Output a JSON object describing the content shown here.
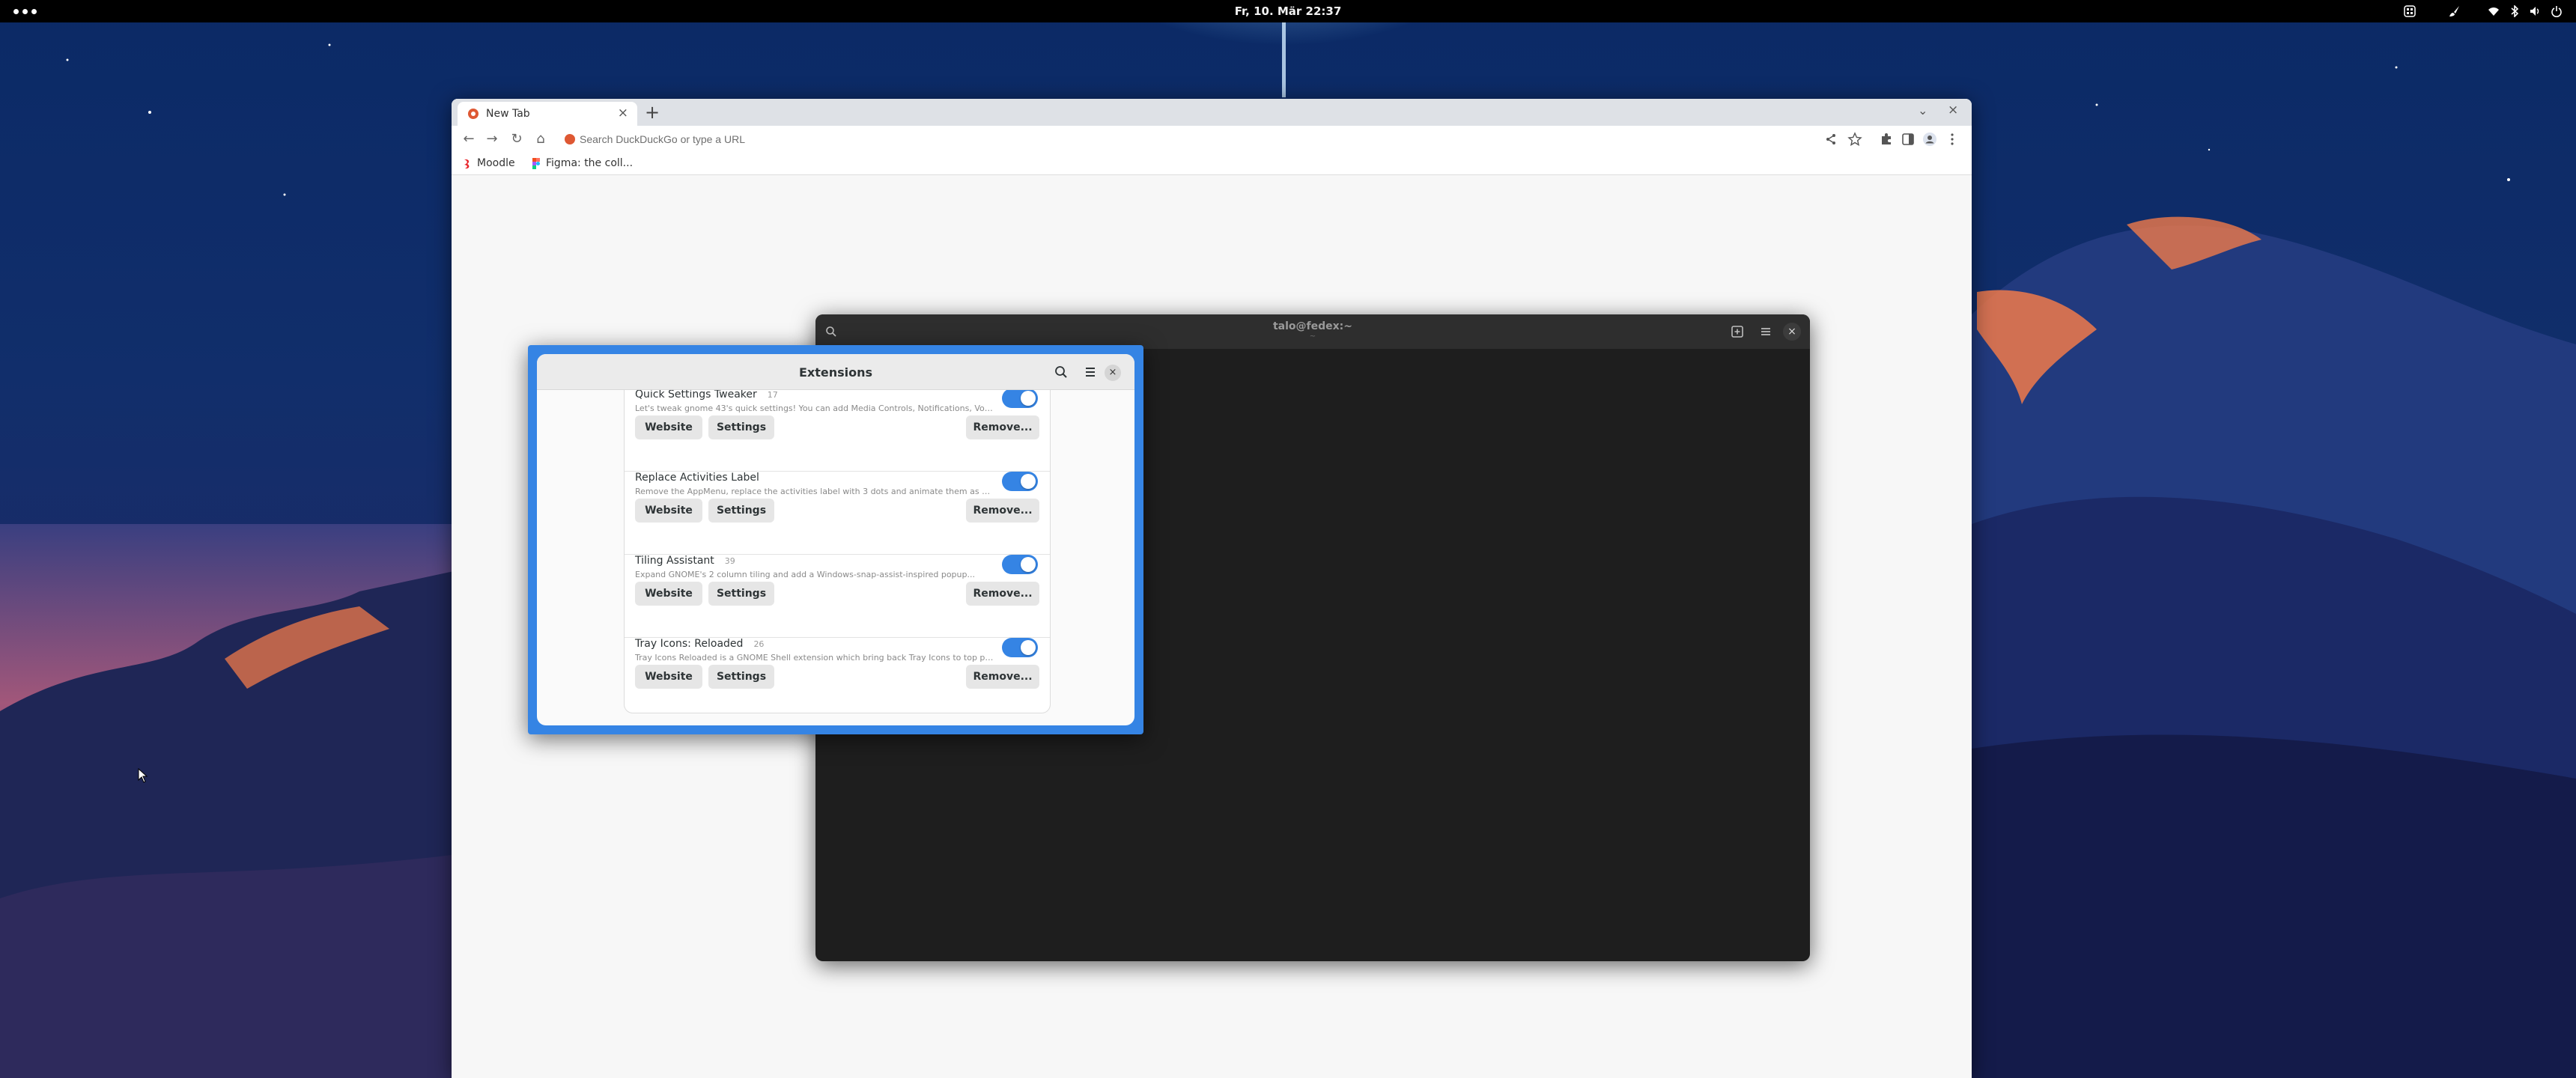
{
  "top_bar": {
    "clock": "Fr, 10. Mär  22:37",
    "tray_icons": [
      "grid-icon",
      "brush-icon",
      "wifi-icon",
      "bluetooth-icon",
      "volume-icon",
      "power-icon"
    ]
  },
  "browser": {
    "tab_title": "New Tab",
    "search_placeholder": "Search DuckDuckGo or type a URL",
    "bookmarks": [
      {
        "label": "Moodle",
        "color": "#e8242a"
      },
      {
        "label": "Figma: the coll...",
        "color": "#f24e1e"
      }
    ]
  },
  "terminal": {
    "title": "talo@fedex:~",
    "subtitle": "~"
  },
  "extensions_window": {
    "title": "Extensions",
    "extensions": [
      {
        "name": "Quick Settings Tweaker",
        "version": "17",
        "description": "Let's tweak gnome 43's quick settings! You can add Media Controls, Notifications, Volume Mixer...",
        "enabled": true
      },
      {
        "name": "Replace Activities Label",
        "version": "",
        "description": "Remove the AppMenu, replace the activities label with 3 dots and animate them as a badge",
        "enabled": true
      },
      {
        "name": "Tiling Assistant",
        "version": "39",
        "description": "Expand GNOME's 2 column tiling and add a Windows-snap-assist-inspired popup...",
        "enabled": true
      },
      {
        "name": "Tray Icons: Reloaded",
        "version": "26",
        "description": "Tray Icons Reloaded is a GNOME Shell extension which bring back Tray Icons to top panel",
        "enabled": true
      }
    ],
    "buttons": {
      "website": "Website",
      "settings": "Settings",
      "remove": "Remove..."
    }
  },
  "colors": {
    "accent": "#3584e4",
    "terminal_bg": "#1e1e1e",
    "top_bar": "#000000"
  }
}
